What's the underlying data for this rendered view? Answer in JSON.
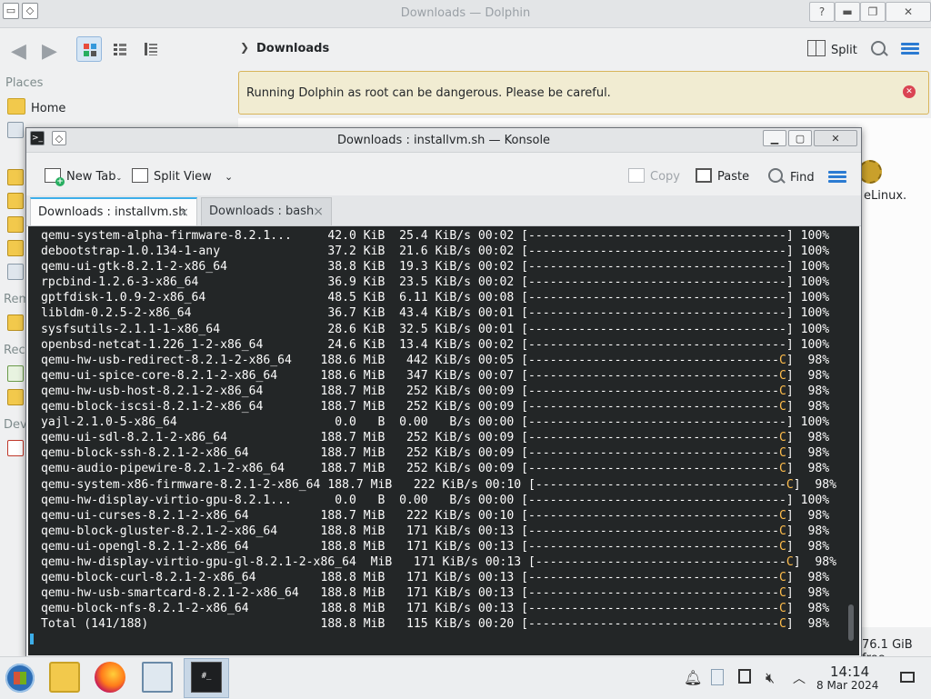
{
  "dolphin": {
    "title": "Downloads — Dolphin",
    "breadcrumb": "Downloads",
    "split_label": "Split",
    "places_label": "Places",
    "home_label": "Home",
    "warning": "Running Dolphin as root can be dangerous. Please be careful.",
    "file_fragment": "eLinux.",
    "free_space": "76.1 GiB free",
    "side_fragments": [
      "Rem",
      "Rec",
      "Dev"
    ]
  },
  "konsole": {
    "title": "Downloads : installvm.sh — Konsole",
    "toolbar": {
      "new_tab": "New Tab",
      "split_view": "Split View",
      "copy": "Copy",
      "paste": "Paste",
      "find": "Find"
    },
    "tabs": [
      {
        "label": "Downloads : installvm.sh",
        "active": true
      },
      {
        "label": "Downloads : bash",
        "active": false
      }
    ],
    "lines": [
      {
        "name": "qemu-system-alpha-firmware-8.2.1...",
        "size": "42.0 KiB",
        "rate": "25.4 KiB/s",
        "time": "00:02",
        "bar": "[------------------------------------]",
        "pct": "100%"
      },
      {
        "name": "debootstrap-1.0.134-1-any",
        "size": "37.2 KiB",
        "rate": "21.6 KiB/s",
        "time": "00:02",
        "bar": "[------------------------------------]",
        "pct": "100%"
      },
      {
        "name": "qemu-ui-gtk-8.2.1-2-x86_64",
        "size": "38.8 KiB",
        "rate": "19.3 KiB/s",
        "time": "00:02",
        "bar": "[------------------------------------]",
        "pct": "100%"
      },
      {
        "name": "rpcbind-1.2.6-3-x86_64",
        "size": "36.9 KiB",
        "rate": "23.5 KiB/s",
        "time": "00:02",
        "bar": "[------------------------------------]",
        "pct": "100%"
      },
      {
        "name": "gptfdisk-1.0.9-2-x86_64",
        "size": "48.5 KiB",
        "rate": "6.11 KiB/s",
        "time": "00:08",
        "bar": "[------------------------------------]",
        "pct": "100%"
      },
      {
        "name": "libldm-0.2.5-2-x86_64",
        "size": "36.7 KiB",
        "rate": "43.4 KiB/s",
        "time": "00:01",
        "bar": "[------------------------------------]",
        "pct": "100%"
      },
      {
        "name": "sysfsutils-2.1.1-1-x86_64",
        "size": "28.6 KiB",
        "rate": "32.5 KiB/s",
        "time": "00:01",
        "bar": "[------------------------------------]",
        "pct": "100%"
      },
      {
        "name": "openbsd-netcat-1.226_1-2-x86_64",
        "size": "24.6 KiB",
        "rate": "13.4 KiB/s",
        "time": "00:02",
        "bar": "[------------------------------------]",
        "pct": "100%"
      },
      {
        "name": "qemu-hw-usb-redirect-8.2.1-2-x86_64",
        "size": "188.6 MiB",
        "rate": "442 KiB/s",
        "time": "00:05",
        "bar": "[-----------------------------------C]",
        "pct": "98%"
      },
      {
        "name": "qemu-ui-spice-core-8.2.1-2-x86_64",
        "size": "188.6 MiB",
        "rate": "347 KiB/s",
        "time": "00:07",
        "bar": "[-----------------------------------C]",
        "pct": "98%"
      },
      {
        "name": "qemu-hw-usb-host-8.2.1-2-x86_64",
        "size": "188.7 MiB",
        "rate": "252 KiB/s",
        "time": "00:09",
        "bar": "[-----------------------------------C]",
        "pct": "98%"
      },
      {
        "name": "qemu-block-iscsi-8.2.1-2-x86_64",
        "size": "188.7 MiB",
        "rate": "252 KiB/s",
        "time": "00:09",
        "bar": "[-----------------------------------C]",
        "pct": "98%"
      },
      {
        "name": "yajl-2.1.0-5-x86_64",
        "size": "0.0   B",
        "rate": "0.00   B/s",
        "time": "00:00",
        "bar": "[------------------------------------]",
        "pct": "100%"
      },
      {
        "name": "qemu-ui-sdl-8.2.1-2-x86_64",
        "size": "188.7 MiB",
        "rate": "252 KiB/s",
        "time": "00:09",
        "bar": "[-----------------------------------C]",
        "pct": "98%"
      },
      {
        "name": "qemu-block-ssh-8.2.1-2-x86_64",
        "size": "188.7 MiB",
        "rate": "252 KiB/s",
        "time": "00:09",
        "bar": "[-----------------------------------C]",
        "pct": "98%"
      },
      {
        "name": "qemu-audio-pipewire-8.2.1-2-x86_64",
        "size": "188.7 MiB",
        "rate": "252 KiB/s",
        "time": "00:09",
        "bar": "[-----------------------------------C]",
        "pct": "98%"
      },
      {
        "name": "qemu-system-x86-firmware-8.2.1-2-x86_64",
        "size": "188.7 MiB",
        "rate": "222 KiB/s",
        "time": "00:10",
        "bar": "[-----------------------------------C]",
        "pct": "98%"
      },
      {
        "name": "qemu-hw-display-virtio-gpu-8.2.1...",
        "size": "0.0   B",
        "rate": "0.00   B/s",
        "time": "00:00",
        "bar": "[------------------------------------]",
        "pct": "100%"
      },
      {
        "name": "qemu-ui-curses-8.2.1-2-x86_64",
        "size": "188.7 MiB",
        "rate": "222 KiB/s",
        "time": "00:10",
        "bar": "[-----------------------------------C]",
        "pct": "98%"
      },
      {
        "name": "qemu-block-gluster-8.2.1-2-x86_64",
        "size": "188.8 MiB",
        "rate": "171 KiB/s",
        "time": "00:13",
        "bar": "[-----------------------------------C]",
        "pct": "98%"
      },
      {
        "name": "qemu-ui-opengl-8.2.1-2-x86_64",
        "size": "188.8 MiB",
        "rate": "171 KiB/s",
        "time": "00:13",
        "bar": "[-----------------------------------C]",
        "pct": "98%"
      },
      {
        "name": "qemu-hw-display-virtio-gpu-gl-8.2.1-2-x86_64",
        "size": "MiB",
        "rate": "171 KiB/s",
        "time": "00:13",
        "bar": "[-----------------------------------C]",
        "pct": "98%"
      },
      {
        "name": "qemu-block-curl-8.2.1-2-x86_64",
        "size": "188.8 MiB",
        "rate": "171 KiB/s",
        "time": "00:13",
        "bar": "[-----------------------------------C]",
        "pct": "98%"
      },
      {
        "name": "qemu-hw-usb-smartcard-8.2.1-2-x86_64",
        "size": "188.8 MiB",
        "rate": "171 KiB/s",
        "time": "00:13",
        "bar": "[-----------------------------------C]",
        "pct": "98%"
      },
      {
        "name": "qemu-block-nfs-8.2.1-2-x86_64",
        "size": "188.8 MiB",
        "rate": "171 KiB/s",
        "time": "00:13",
        "bar": "[-----------------------------------C]",
        "pct": "98%"
      },
      {
        "name": "Total (141/188)",
        "size": "188.8 MiB",
        "rate": "115 KiB/s",
        "time": "00:20",
        "bar": "[-----------------------------------C]",
        "pct": "98%"
      }
    ]
  },
  "taskbar": {
    "time": "14:14",
    "date": "8 Mar 2024",
    "items": [
      "start-menu",
      "file-manager",
      "firefox",
      "system-settings",
      "konsole"
    ]
  },
  "colors": {
    "terminal_bg": "#232627",
    "terminal_fg": "#fcfcfc",
    "pacman_c": "#fdbc4b",
    "accent": "#3daee9",
    "warning_bg": "#f1ecd2"
  }
}
